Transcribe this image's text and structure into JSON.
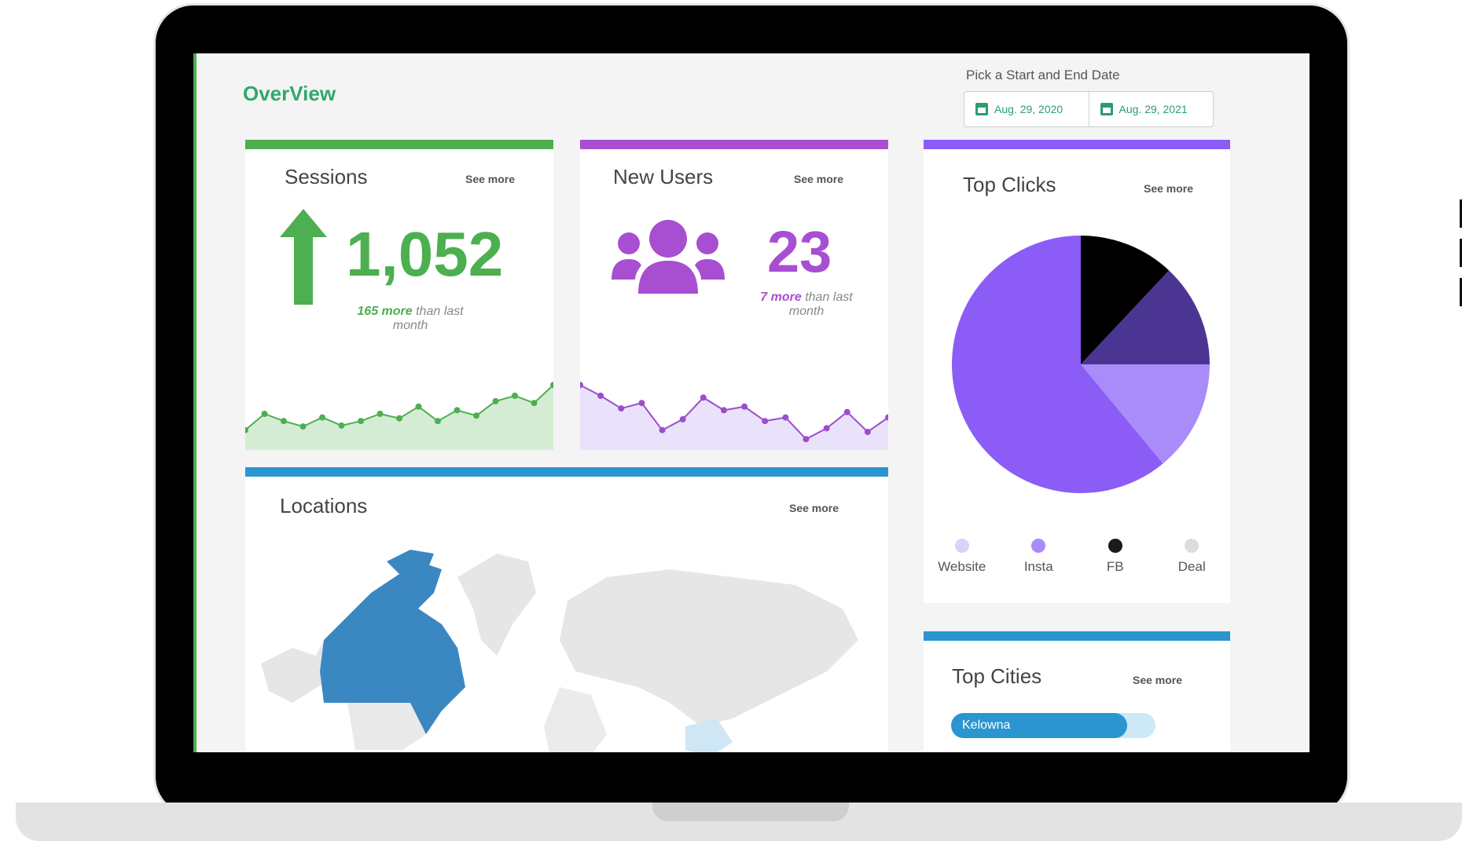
{
  "header": {
    "title": "OverView",
    "date_caption": "Pick a Start and End Date",
    "start_date": "Aug. 29, 2020",
    "end_date": "Aug. 29, 2021"
  },
  "see_more": "See more",
  "sessions": {
    "title": "Sessions",
    "value": "1,052",
    "delta_strong": "165 more",
    "delta_rest": " than last month",
    "color": "#4caf50",
    "sparkline": [
      22,
      40,
      32,
      26,
      36,
      27,
      32,
      40,
      35,
      48,
      32,
      44,
      38,
      54,
      60,
      52,
      72
    ]
  },
  "new_users": {
    "title": "New Users",
    "value": "23",
    "delta_strong": "7 more",
    "delta_rest": " than last month",
    "color": "#9c4dcc",
    "sparkline": [
      72,
      60,
      46,
      52,
      22,
      34,
      58,
      44,
      48,
      32,
      36,
      12,
      24,
      42,
      20,
      36
    ]
  },
  "locations": {
    "title": "Locations",
    "color": "#2a95cf"
  },
  "top_clicks": {
    "title": "Top Clicks",
    "color": "#8b5cf6",
    "slices": [
      {
        "label": "FB",
        "value": 12,
        "color": "#000000"
      },
      {
        "label": "Deal",
        "value": 13,
        "color": "#4b3592"
      },
      {
        "label": "Website",
        "value": 14,
        "color": "#a98cf9"
      },
      {
        "label": "Insta",
        "value": 61,
        "color": "#8b5cf6"
      }
    ],
    "legend": [
      {
        "label": "Website",
        "color": "#ddd0fb"
      },
      {
        "label": "Insta",
        "color": "#a98cf9"
      },
      {
        "label": "FB",
        "color": "#1a1a1a"
      },
      {
        "label": "Deal",
        "color": "#dddddd"
      }
    ]
  },
  "top_cities": {
    "title": "Top Cities",
    "color": "#2a95cf",
    "cities": [
      {
        "name": "Kelowna",
        "share": 0.86
      }
    ]
  }
}
